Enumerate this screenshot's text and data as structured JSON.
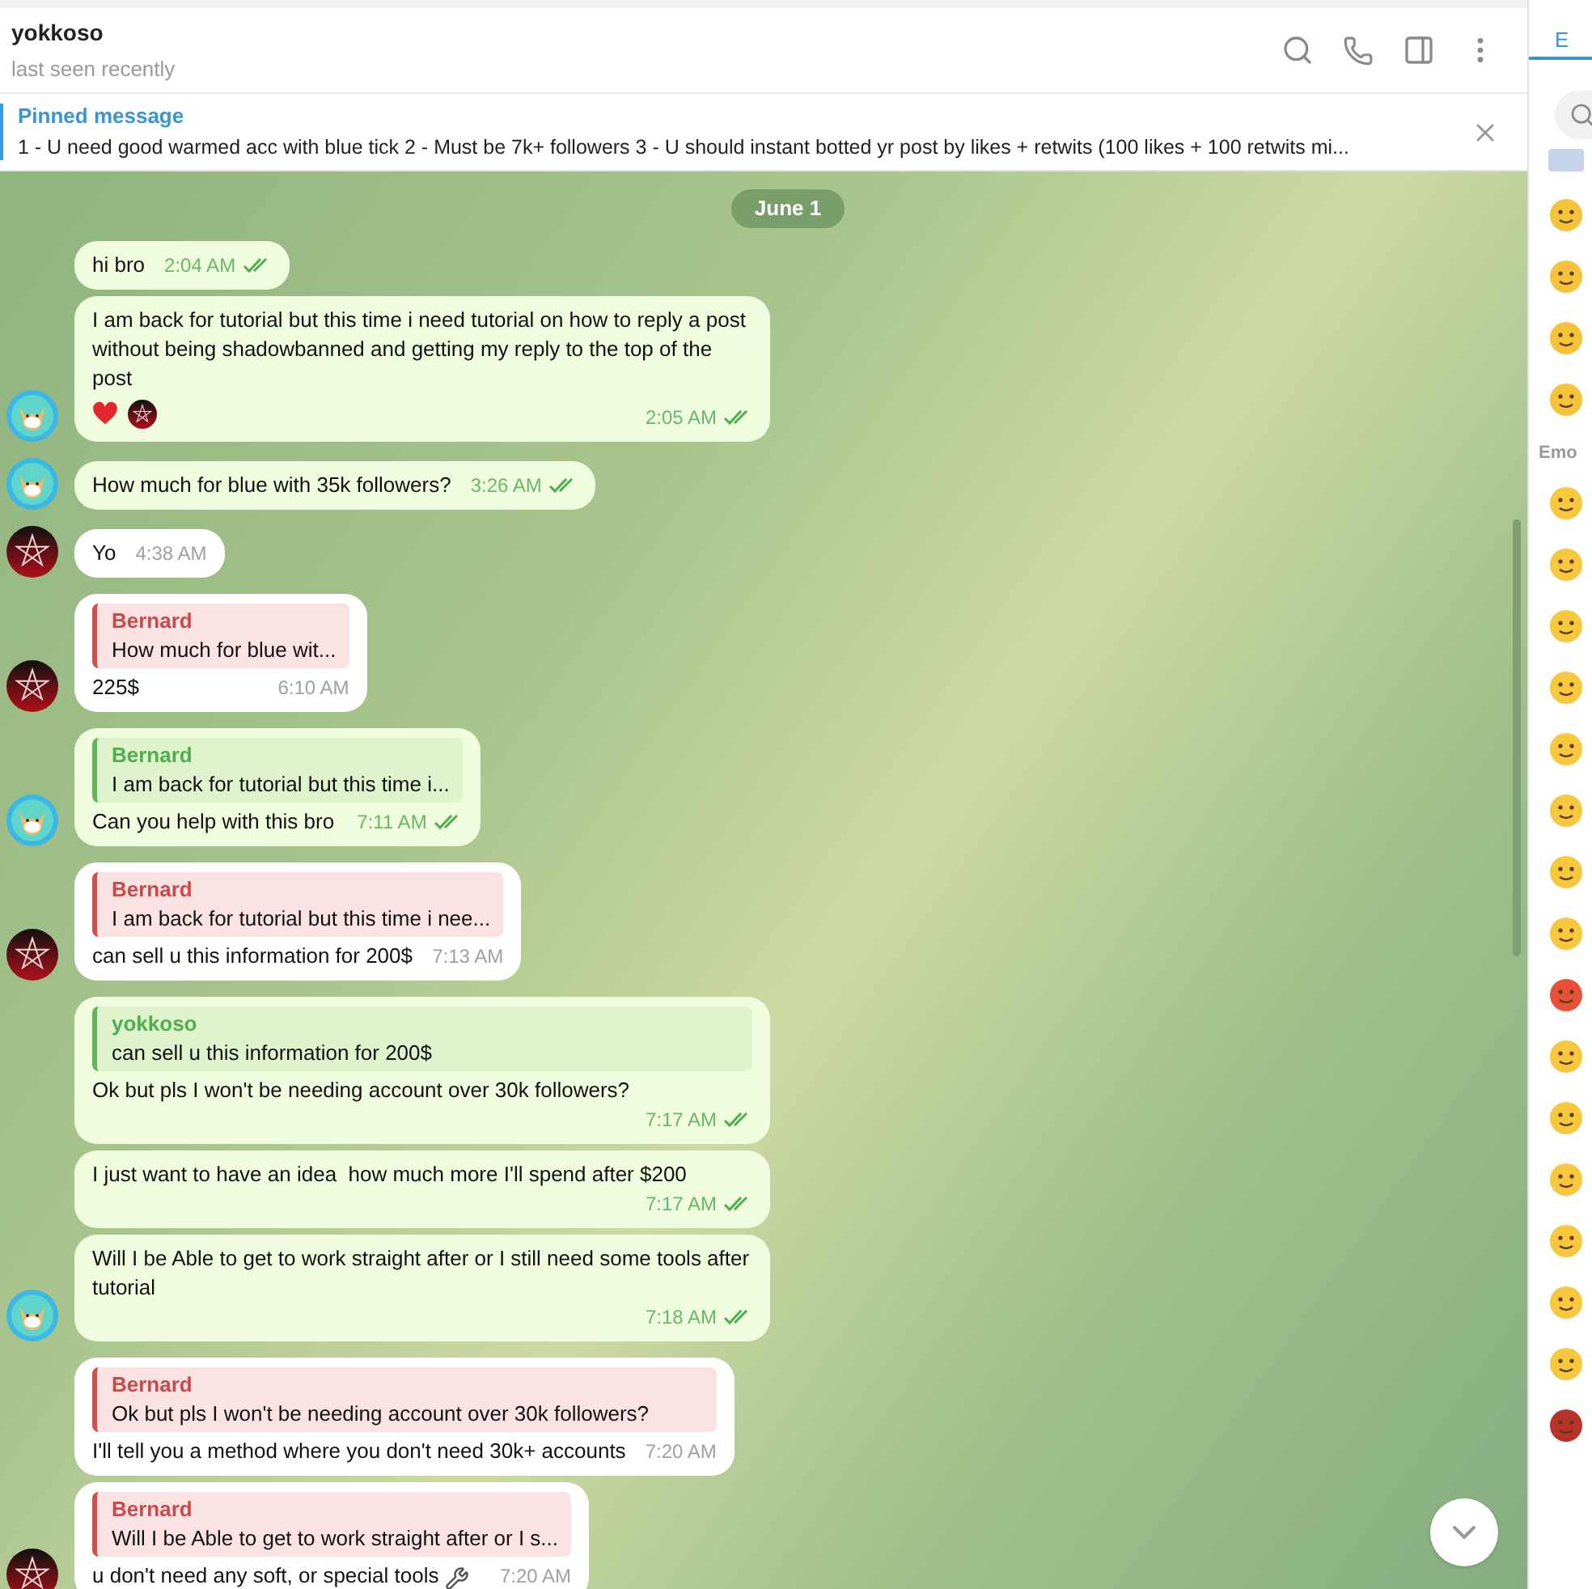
{
  "header": {
    "title": "yokkoso",
    "status": "last seen recently"
  },
  "pinned": {
    "label": "Pinned message",
    "text": "1 - U need good warmed acc with blue tick  2 - Must be 7k+ followers 3 - U should instant botted yr post by likes + retwits (100 likes + 100 retwits mi..."
  },
  "date": "June 1",
  "messages": [
    {
      "kind": "out",
      "text": "hi bro",
      "time": "2:04 AM",
      "avatar": false
    },
    {
      "kind": "out",
      "text": "I am back for tutorial but this time i need tutorial on how to reply a post without being shadowbanned and getting my reply to the top of the post",
      "time": "2:05 AM",
      "avatar": true,
      "reactions": [
        {
          "kind": "heart"
        },
        {
          "kind": "user"
        }
      ]
    },
    {
      "kind": "out",
      "text": "How much for blue with 35k followers?",
      "time": "3:26 AM",
      "avatar": true
    },
    {
      "kind": "in",
      "text": "Yo",
      "time": "4:38 AM",
      "avatar": true
    },
    {
      "kind": "in",
      "reply": {
        "name": "Bernard",
        "text": "How much for blue wit..."
      },
      "text": "225$",
      "time": "6:10 AM",
      "avatar": true
    },
    {
      "kind": "out",
      "reply": {
        "name": "Bernard",
        "text": "I am back for tutorial but this time i..."
      },
      "text": "Can you help with this bro",
      "time": "7:11 AM",
      "avatar": true
    },
    {
      "kind": "in",
      "reply": {
        "name": "Bernard",
        "text": "I am back for tutorial but this time i nee..."
      },
      "text": "can sell u this information for 200$",
      "time": "7:13 AM",
      "avatar": true
    },
    {
      "kind": "out",
      "reply": {
        "name": "yokkoso",
        "text": "can sell u this information for 200$"
      },
      "text": "Ok but pls I won't be needing account over 30k followers?",
      "time": "7:17 AM",
      "avatar": false
    },
    {
      "kind": "out",
      "text": "I just want to have an idea  how much more I'll spend after $200",
      "time": "7:17 AM",
      "avatar": false
    },
    {
      "kind": "out",
      "text": "Will I be Able to get to work straight after or I still need some tools after tutorial",
      "time": "7:18 AM",
      "avatar": true
    },
    {
      "kind": "in",
      "reply": {
        "name": "Bernard",
        "text": "Ok but pls I won't be needing account over 30k followers?"
      },
      "text": "I'll tell you a method where you don't need 30k+ accounts",
      "time": "7:20 AM",
      "avatar": false
    },
    {
      "kind": "in",
      "reply": {
        "name": "Bernard",
        "text": "Will I be Able to get to work straight after or I s..."
      },
      "text": "u don't need any soft, or special tools",
      "tools_icon": true,
      "time": "7:20 AM",
      "avatar": true
    }
  ],
  "emoji_panel": {
    "tab": "E",
    "section": "Emo"
  }
}
